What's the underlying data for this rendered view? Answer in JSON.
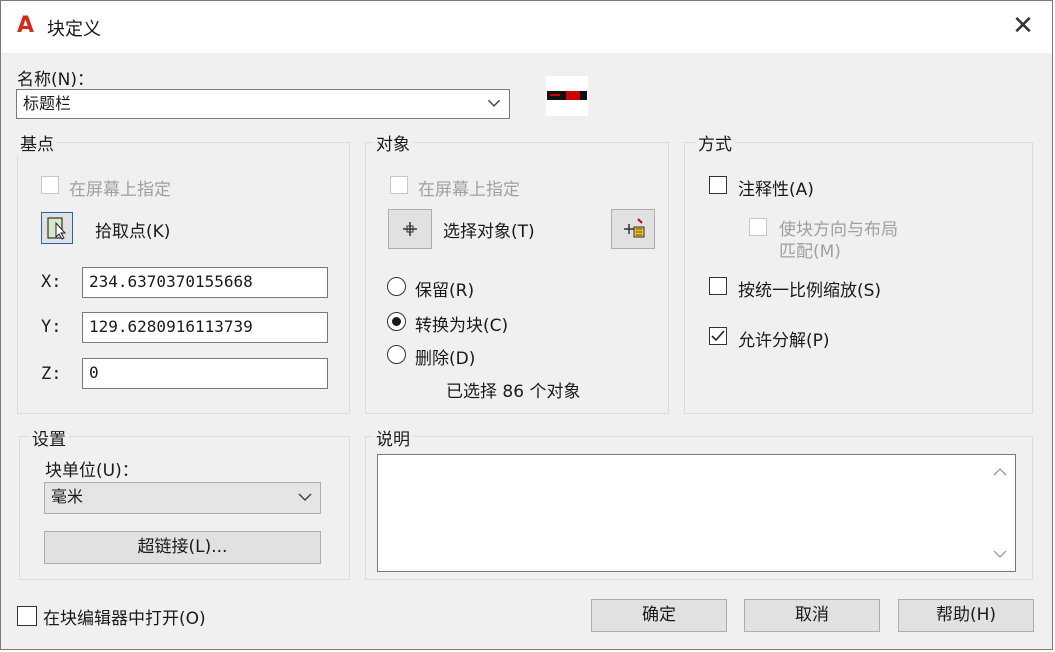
{
  "window": {
    "title": "块定义",
    "app_icon": "autocad-logo",
    "app_letter": "A",
    "close_glyph": "✕"
  },
  "name_field": {
    "label": "名称(N)：",
    "value": "标题栏",
    "preview_icon": "block-preview-thumbnail"
  },
  "base_point": {
    "title": "基点",
    "specify_on_screen": "在屏幕上指定",
    "pick_point": "拾取点(K)",
    "x_label": "X:",
    "x_value": "234.6370370155668",
    "y_label": "Y:",
    "y_value": "129.6280916113739",
    "z_label": "Z:",
    "z_value": "0"
  },
  "objects": {
    "title": "对象",
    "specify_on_screen": "在屏幕上指定",
    "select_objects": "选择对象(T)",
    "retain": "保留(R)",
    "convert_to_block": "转换为块(C)",
    "delete": "删除(D)",
    "selected_count_text": "已选择 86 个对象",
    "selected_option": "convert_to_block"
  },
  "behavior": {
    "title": "方式",
    "annotative": "注释性(A)",
    "match_orientation": "使块方向与布局",
    "match_orientation_2": "匹配(M)",
    "scale_uniformly": "按统一比例缩放(S)",
    "allow_exploding": "允许分解(P)",
    "annotative_checked": false,
    "scale_uniformly_checked": false,
    "allow_exploding_checked": true
  },
  "settings": {
    "title": "设置",
    "block_unit_label": "块单位(U)：",
    "block_unit_value": "毫米",
    "hyperlink_button": "超链接(L)..."
  },
  "description": {
    "title": "说明",
    "value": ""
  },
  "footer": {
    "open_in_editor": "在块编辑器中打开(O)",
    "ok": "确定",
    "cancel": "取消",
    "help": "帮助(H)"
  },
  "colors": {
    "brand_red": "#d52b1e",
    "dialog_bg": "#f0f0f0",
    "titlebar_bg": "#ffffff"
  }
}
